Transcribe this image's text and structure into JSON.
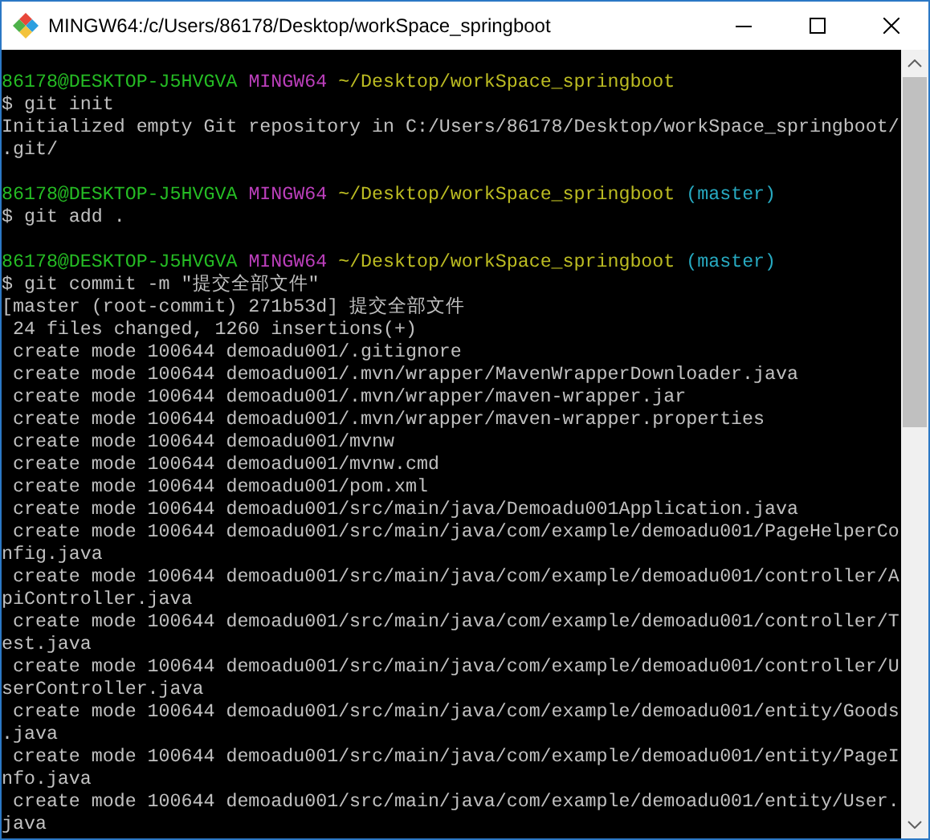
{
  "window": {
    "title": "MINGW64:/c/Users/86178/Desktop/workSpace_springboot"
  },
  "terminal": {
    "lines": [
      {
        "kind": "prompt",
        "segments": [
          {
            "kind": "user",
            "text": "86178@DESKTOP-J5HVGVA"
          },
          {
            "kind": "host",
            "text": "MINGW64"
          },
          {
            "kind": "path",
            "text": "~/Desktop/workSpace_springboot"
          }
        ]
      },
      {
        "kind": "text",
        "text": "$ git init"
      },
      {
        "kind": "text",
        "text": "Initialized empty Git repository in C:/Users/86178/Desktop/workSpace_springboot/"
      },
      {
        "kind": "text",
        "text": ".git/"
      },
      {
        "kind": "blank"
      },
      {
        "kind": "prompt",
        "segments": [
          {
            "kind": "user",
            "text": "86178@DESKTOP-J5HVGVA"
          },
          {
            "kind": "host",
            "text": "MINGW64"
          },
          {
            "kind": "path",
            "text": "~/Desktop/workSpace_springboot"
          },
          {
            "kind": "branch",
            "text": "(master)"
          }
        ]
      },
      {
        "kind": "text",
        "text": "$ git add ."
      },
      {
        "kind": "blank"
      },
      {
        "kind": "prompt",
        "segments": [
          {
            "kind": "user",
            "text": "86178@DESKTOP-J5HVGVA"
          },
          {
            "kind": "host",
            "text": "MINGW64"
          },
          {
            "kind": "path",
            "text": "~/Desktop/workSpace_springboot"
          },
          {
            "kind": "branch",
            "text": "(master)"
          }
        ]
      },
      {
        "kind": "text",
        "text": "$ git commit -m \"提交全部文件\""
      },
      {
        "kind": "text",
        "text": "[master (root-commit) 271b53d] 提交全部文件"
      },
      {
        "kind": "text",
        "text": " 24 files changed, 1260 insertions(+)"
      },
      {
        "kind": "text",
        "text": " create mode 100644 demoadu001/.gitignore"
      },
      {
        "kind": "text",
        "text": " create mode 100644 demoadu001/.mvn/wrapper/MavenWrapperDownloader.java"
      },
      {
        "kind": "text",
        "text": " create mode 100644 demoadu001/.mvn/wrapper/maven-wrapper.jar"
      },
      {
        "kind": "text",
        "text": " create mode 100644 demoadu001/.mvn/wrapper/maven-wrapper.properties"
      },
      {
        "kind": "text",
        "text": " create mode 100644 demoadu001/mvnw"
      },
      {
        "kind": "text",
        "text": " create mode 100644 demoadu001/mvnw.cmd"
      },
      {
        "kind": "text",
        "text": " create mode 100644 demoadu001/pom.xml"
      },
      {
        "kind": "text",
        "text": " create mode 100644 demoadu001/src/main/java/Demoadu001Application.java"
      },
      {
        "kind": "text",
        "text": " create mode 100644 demoadu001/src/main/java/com/example/demoadu001/PageHelperCo"
      },
      {
        "kind": "text",
        "text": "nfig.java"
      },
      {
        "kind": "text",
        "text": " create mode 100644 demoadu001/src/main/java/com/example/demoadu001/controller/A"
      },
      {
        "kind": "text",
        "text": "piController.java"
      },
      {
        "kind": "text",
        "text": " create mode 100644 demoadu001/src/main/java/com/example/demoadu001/controller/T"
      },
      {
        "kind": "text",
        "text": "est.java"
      },
      {
        "kind": "text",
        "text": " create mode 100644 demoadu001/src/main/java/com/example/demoadu001/controller/U"
      },
      {
        "kind": "text",
        "text": "serController.java"
      },
      {
        "kind": "text",
        "text": " create mode 100644 demoadu001/src/main/java/com/example/demoadu001/entity/Goods"
      },
      {
        "kind": "text",
        "text": ".java"
      },
      {
        "kind": "text",
        "text": " create mode 100644 demoadu001/src/main/java/com/example/demoadu001/entity/PageI"
      },
      {
        "kind": "text",
        "text": "nfo.java"
      },
      {
        "kind": "text",
        "text": " create mode 100644 demoadu001/src/main/java/com/example/demoadu001/entity/User."
      },
      {
        "kind": "text",
        "text": "java"
      }
    ]
  }
}
